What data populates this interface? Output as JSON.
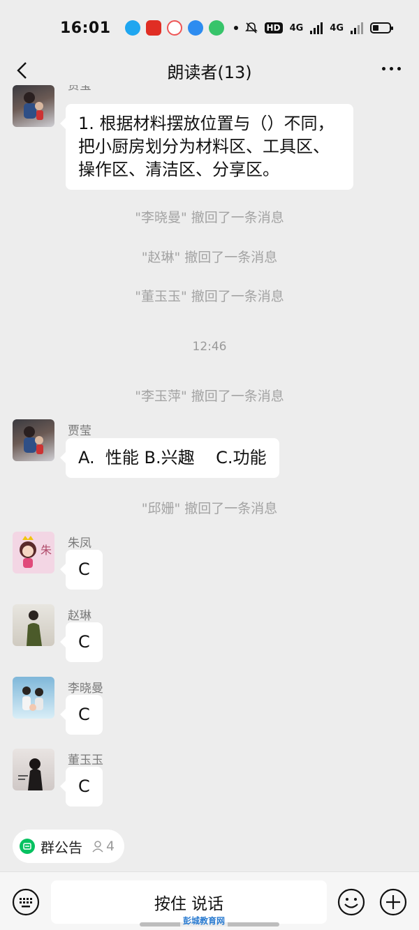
{
  "status_bar": {
    "time": "16:01",
    "hd": "HD",
    "net1": "4G",
    "net2": "4G",
    "battery_level": 0.35
  },
  "header": {
    "title": "朗读者(13)"
  },
  "messages": [
    {
      "sender": "贾莹",
      "text_lines": [
        "1. 根据材料摆放位置与（）不同，",
        "把小厨房划分为材料区、工具区、",
        "操作区、清洁区、分享区。"
      ]
    },
    {
      "sender": "贾莹",
      "text": "A.  性能 B.兴趣    C.功能"
    },
    {
      "sender": "朱凤",
      "text": "C"
    },
    {
      "sender": "赵琳",
      "text": "C"
    },
    {
      "sender": "李晓曼",
      "text": "C"
    },
    {
      "sender": "董玉玉",
      "text": "C"
    }
  ],
  "system": [
    "\"李晓曼\" 撤回了一条消息",
    "\"赵琳\" 撤回了一条消息",
    "\"董玉玉\" 撤回了一条消息",
    "12:46",
    "\"李玉萍\" 撤回了一条消息",
    "\"邱姗\" 撤回了一条消息"
  ],
  "notice": {
    "label": "群公告",
    "member_count": "4"
  },
  "input": {
    "voice_label": "按住 说话"
  },
  "watermark": "彭城教育网",
  "colors": {
    "accent": "#07c160",
    "background": "#ededed",
    "bubble": "#ffffff"
  }
}
